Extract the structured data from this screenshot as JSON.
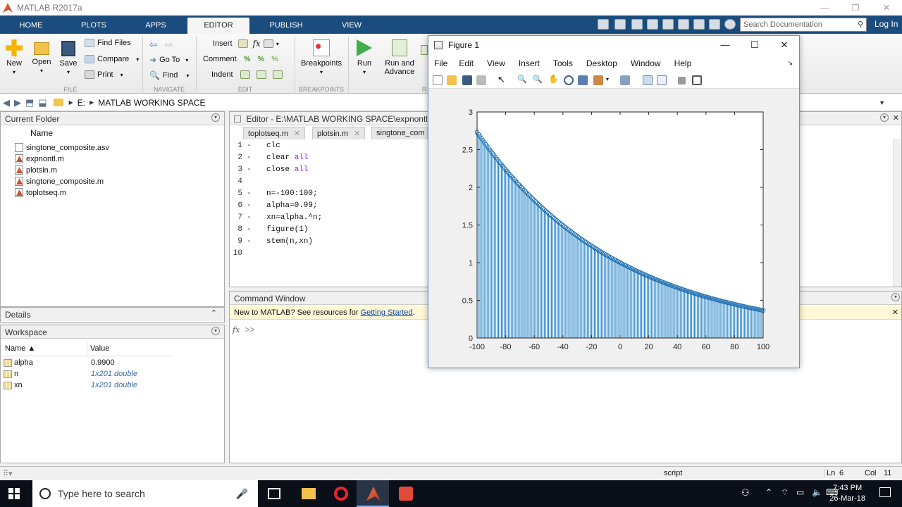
{
  "window": {
    "title": "MATLAB R2017a",
    "login": "Log In"
  },
  "ribbon_tabs": [
    "HOME",
    "PLOTS",
    "APPS",
    "EDITOR",
    "PUBLISH",
    "VIEW"
  ],
  "search": {
    "placeholder": "Search Documentation"
  },
  "ribbon": {
    "new": "New",
    "open": "Open",
    "save": "Save",
    "find_files": "Find Files",
    "compare": "Compare",
    "print": "Print",
    "go_to": "Go To",
    "find": "Find",
    "insert": "Insert",
    "comment": "Comment",
    "indent": "Indent",
    "breakpoints": "Breakpoints",
    "run": "Run",
    "run_advance_1": "Run and",
    "run_advance_2": "Advance",
    "run_label_partial": "R",
    "groups": {
      "file": "FILE",
      "navigate": "NAVIGATE",
      "edit": "EDIT",
      "breakpoints": "BREAKPOINTS"
    }
  },
  "address": {
    "drive": "E:",
    "folder": "MATLAB WORKING SPACE",
    "sep1": "▶",
    "sep2": "▶"
  },
  "current_folder": {
    "title": "Current Folder",
    "column": "Name",
    "files": [
      {
        "name": "singtone_composite.asv",
        "type": "asv"
      },
      {
        "name": "expnontl.m",
        "type": "m"
      },
      {
        "name": "plotsin.m",
        "type": "m"
      },
      {
        "name": "singtone_composite.m",
        "type": "m"
      },
      {
        "name": "toplotseq.m",
        "type": "m"
      }
    ]
  },
  "details": {
    "title": "Details"
  },
  "workspace": {
    "title": "Workspace",
    "col_name": "Name ▲",
    "col_value": "Value",
    "vars": [
      {
        "name": "alpha",
        "value": "0.9900"
      },
      {
        "name": "n",
        "value": "1x201 double"
      },
      {
        "name": "xn",
        "value": "1x201 double"
      }
    ]
  },
  "editor": {
    "title": "Editor - E:\\MATLAB WORKING SPACE\\expnontl.m",
    "tabs": [
      "toplotseq.m",
      "plotsin.m",
      "singtone_com"
    ],
    "lines": [
      {
        "num": "1",
        "dash": "-",
        "code": "clc",
        "kw": ""
      },
      {
        "num": "2",
        "dash": "-",
        "code": "clear ",
        "kw": "all"
      },
      {
        "num": "3",
        "dash": "-",
        "code": "close ",
        "kw": "all"
      },
      {
        "num": "4",
        "dash": "",
        "code": "",
        "kw": ""
      },
      {
        "num": "5",
        "dash": "-",
        "code": "n=-100:100;",
        "kw": ""
      },
      {
        "num": "6",
        "dash": "-",
        "code": "alpha=0.99;",
        "kw": ""
      },
      {
        "num": "7",
        "dash": "-",
        "code": "xn=alpha.^n;",
        "kw": ""
      },
      {
        "num": "8",
        "dash": "-",
        "code": "figure(1)",
        "kw": ""
      },
      {
        "num": "9",
        "dash": "-",
        "code": "stem(n,xn)",
        "kw": ""
      },
      {
        "num": "10",
        "dash": "",
        "code": "",
        "kw": ""
      }
    ]
  },
  "command_window": {
    "title": "Command Window",
    "notice": "New to MATLAB? See resources for ",
    "link": "Getting Started",
    "notice_end": ".",
    "fx": "fx",
    "prompt": ">>"
  },
  "figure": {
    "title": "Figure 1",
    "menu": [
      "File",
      "Edit",
      "View",
      "Insert",
      "Tools",
      "Desktop",
      "Window",
      "Help"
    ]
  },
  "chart_data": {
    "type": "stem",
    "title": "",
    "xlabel": "",
    "ylabel": "",
    "xlim": [
      -100,
      100
    ],
    "ylim": [
      0,
      3
    ],
    "xticks": [
      "-100",
      "-80",
      "-60",
      "-40",
      "-20",
      "0",
      "20",
      "40",
      "60",
      "80",
      "100"
    ],
    "yticks": [
      "0",
      "0.5",
      "1",
      "1.5",
      "2",
      "2.5",
      "3"
    ],
    "x_range": [
      -100,
      100
    ],
    "step": 1,
    "formula": "0.99^n",
    "alpha": 0.99,
    "line_color": "#2a86c9",
    "marker": "circle"
  },
  "statusbar": {
    "mode": "script",
    "ln_label": "Ln",
    "ln": "6",
    "col_label": "Col",
    "col": "11"
  },
  "taskbar": {
    "search": "Type here to search",
    "time": "7:43 PM",
    "date": "26-Mar-18"
  }
}
